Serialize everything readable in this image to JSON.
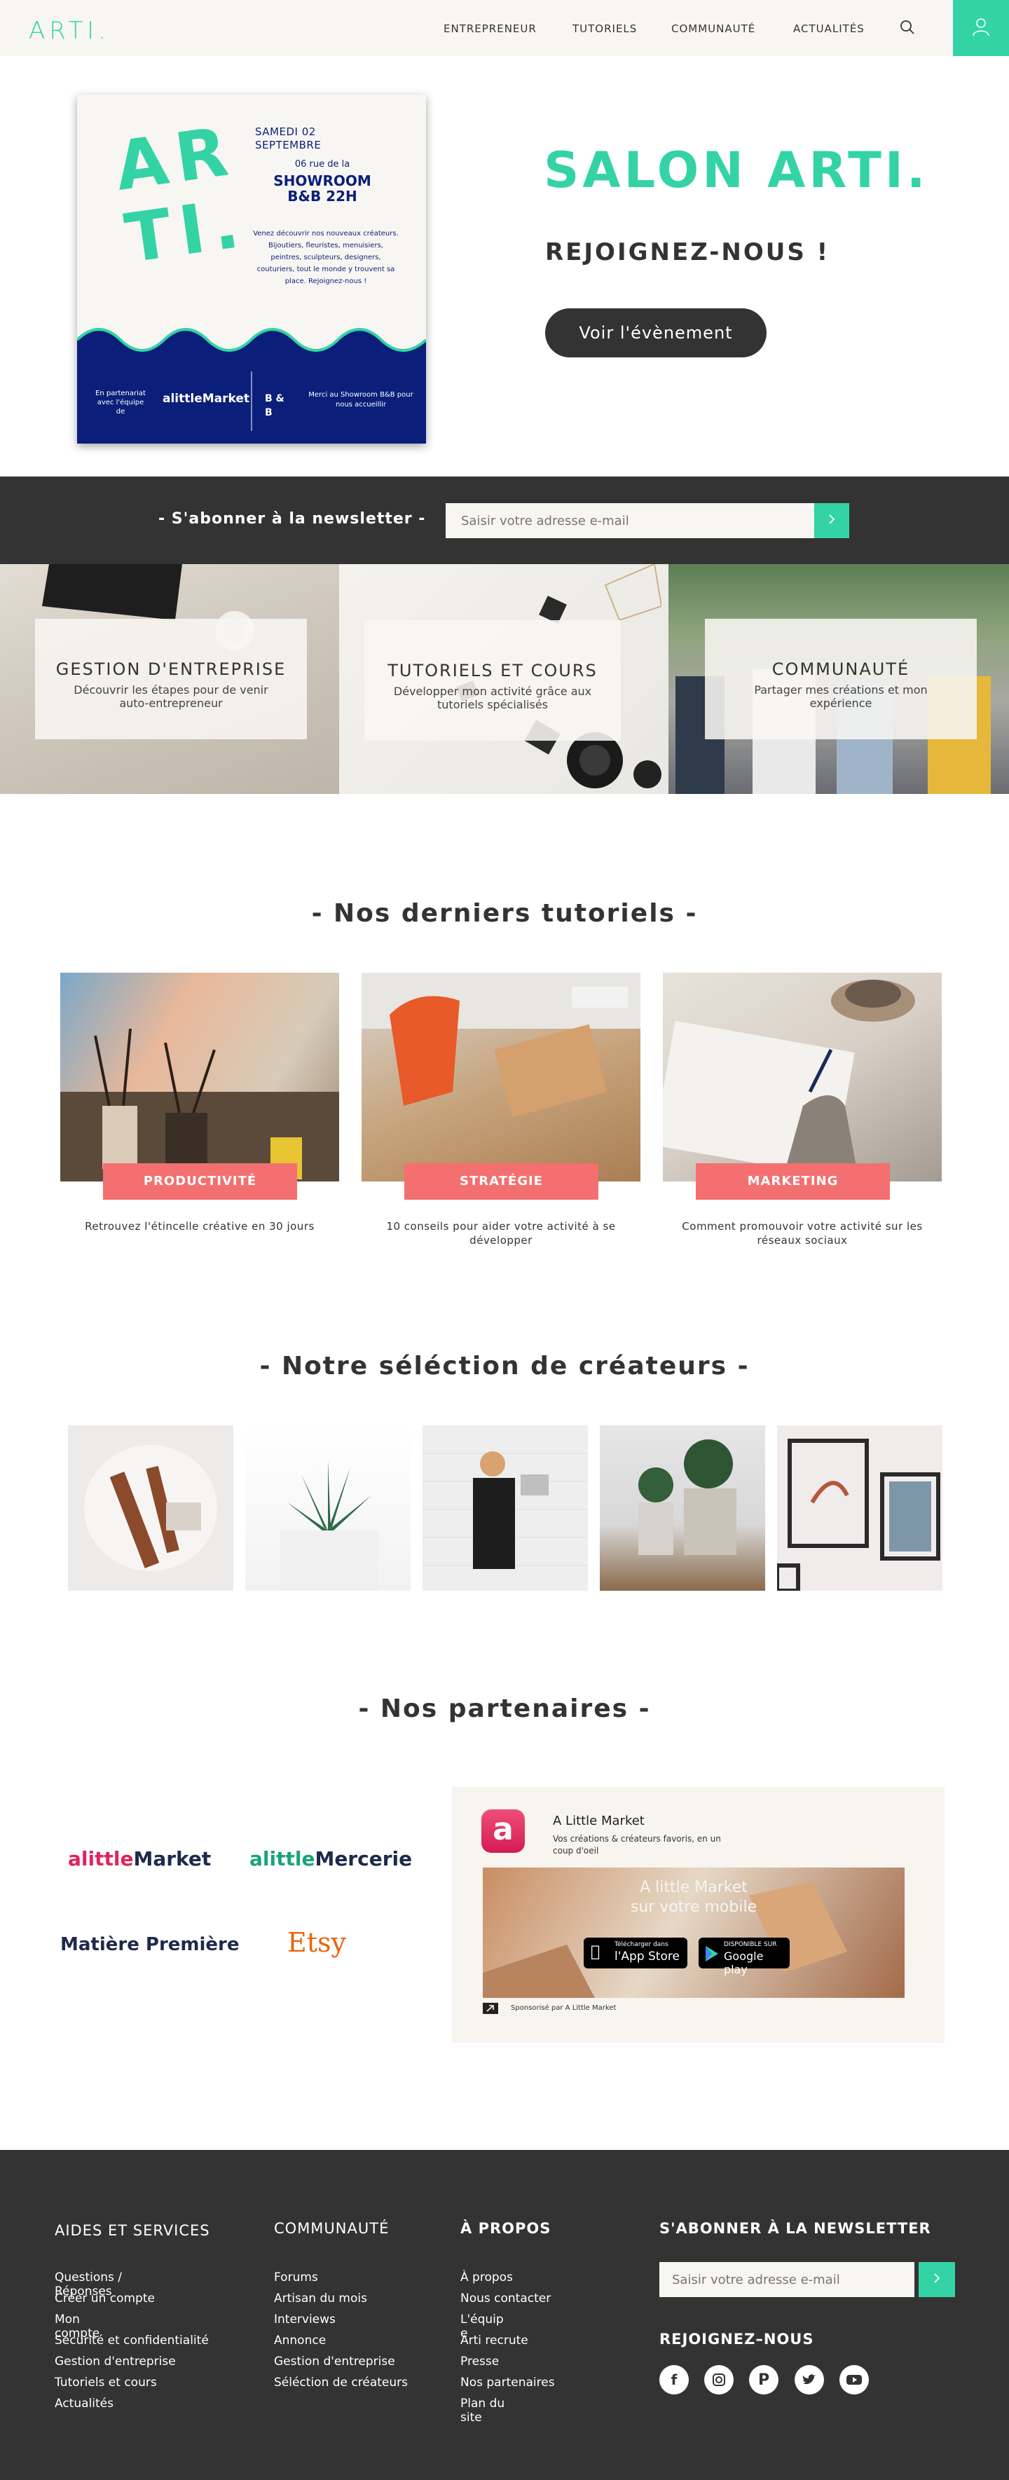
{
  "colors": {
    "accent": "#33d3a6",
    "dark": "#333333",
    "cream": "#f8f6f3",
    "coral": "#f46f6f",
    "navy": "#0b1f7a"
  },
  "header": {
    "logo": "ARTI.",
    "nav": [
      "ENTREPRENEUR",
      "TUTORIELS",
      "COMMUNAUTÉ",
      "ACTUALITÉS"
    ],
    "icons": [
      "search-icon",
      "user-icon"
    ]
  },
  "hero": {
    "poster": {
      "logo": "AR TI.",
      "date": "SAMEDI 02 SEPTEMBRE",
      "address": "06 rue de la",
      "showroom": "SHOWROOM B&B 22H",
      "text": "Venez découvrir nos nouveaux créateurs. Bijoutiers, fleuristes, menuisiers, peintres, sculpteurs, designers, couturiers, tout le monde y trouvent sa place. Rejoignez-nous !",
      "partner": "En partenariat avec l'équipe de",
      "partner_logo": "alittleMarket",
      "bb": "B & B",
      "thanks": "Merci au Showroom B&B pour nous accueillir"
    },
    "title": "SALON ARTI.",
    "subtitle": "REJOIGNEZ-NOUS !",
    "button": "Voir l'évènement"
  },
  "newsletter": {
    "label": "- S'abonner à la newsletter -",
    "placeholder": "Saisir votre adresse e-mail"
  },
  "categories": [
    {
      "title": "GESTION D'ENTREPRISE",
      "desc": "Découvrir les étapes pour de venir auto-entrepreneur"
    },
    {
      "title": "TUTORIELS ET COURS",
      "desc": "Développer mon activité grâce aux tutoriels spécialisés"
    },
    {
      "title": "COMMUNAUTÉ",
      "desc": "Partager mes créations et mon expérience"
    }
  ],
  "tutorials": {
    "title": "- Nos derniers tutoriels -",
    "items": [
      {
        "tag": "PRODUCTIVITÉ",
        "caption": "Retrouvez l'étincelle créative en 30 jours"
      },
      {
        "tag": "STRATÉGIE",
        "caption": "10 conseils pour aider votre activité à se développer"
      },
      {
        "tag": "MARKETING",
        "caption": "Comment promouvoir votre activité sur les réseaux sociaux"
      }
    ]
  },
  "creators": {
    "title": "- Notre séléction de créateurs -"
  },
  "partners": {
    "title": "- Nos partenaires -",
    "logos": [
      "alittleMarket",
      "alittleMercerie",
      "Matière Première",
      "Etsy"
    ],
    "ad": {
      "name": "A Little Market",
      "desc": "Vos créations & créateurs favoris, en un coup d'oeil",
      "banner_line1": "A little Market",
      "banner_line2": "sur votre mobile",
      "appstore_small": "Télécharger dans",
      "appstore": "l'App Store",
      "googleplay_small": "DISPONIBLE SUR",
      "googleplay": "Google play",
      "sponsored": "Sponsorisé par A Little Market"
    }
  },
  "footer": {
    "col1": {
      "heading": "AIDES ET SERVICES",
      "links": [
        "Questions / Réponses",
        "Créer un compte",
        "Mon compte",
        "Sécurité et confidentialité",
        "Gestion d'entreprise",
        "Tutoriels et cours",
        "Actualités"
      ]
    },
    "col2": {
      "heading": "COMMUNAUTÉ",
      "links": [
        "Forums",
        "Artisan du mois",
        "Interviews",
        "Annonce",
        "Gestion d'entreprise",
        "Séléction de créateurs"
      ]
    },
    "col3": {
      "heading": "À PROPOS",
      "links": [
        "À propos",
        "Nous contacter",
        "L'équip e",
        "Arti recrute",
        "Presse",
        "Nos partenaires",
        "Plan du site"
      ]
    },
    "newsletter_heading": "S'ABONNER À LA NEWSLETTER",
    "newsletter_placeholder": "Saisir votre adresse e-mail",
    "join_heading": "REJOIGNEZ–NOUS",
    "social": [
      "facebook-icon",
      "instagram-icon",
      "pinterest-icon",
      "twitter-icon",
      "youtube-icon"
    ]
  }
}
